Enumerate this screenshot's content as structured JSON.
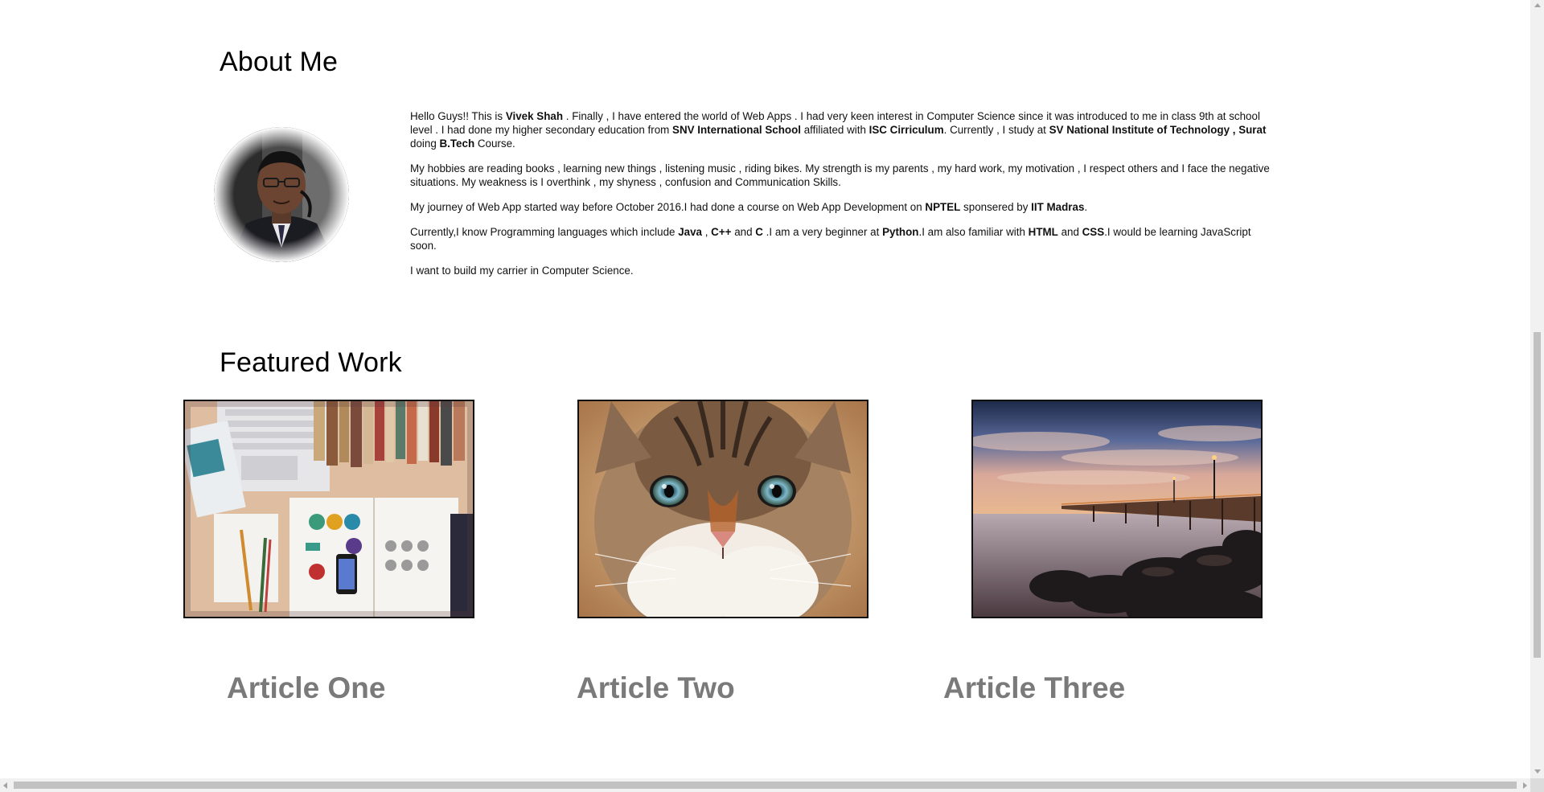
{
  "about": {
    "title": "About Me",
    "avatar_alt": "profile photo",
    "paragraphs": [
      [
        {
          "t": "Hello Guys!! This is "
        },
        {
          "t": "Vivek Shah",
          "b": true
        },
        {
          "t": " . Finally , I have entered the world of Web Apps . I had very keen interest in Computer Science since it was introduced to me in class 9th at school level . I had done my higher secondary education from "
        },
        {
          "t": "SNV International School",
          "b": true
        },
        {
          "t": " affiliated with "
        },
        {
          "t": "ISC Cirriculum",
          "b": true
        },
        {
          "t": ". Currently , I study at "
        },
        {
          "t": "SV National Institute of Technology , Surat",
          "b": true
        },
        {
          "t": " doing "
        },
        {
          "t": "B.Tech",
          "b": true
        },
        {
          "t": " Course."
        }
      ],
      [
        {
          "t": "My hobbies are reading books , learning new things , listening music , riding bikes. My strength is my parents , my hard work, my motivation , I respect others and I face the negative situations. My weakness is I overthink , my shyness , confusion and Communication Skills."
        }
      ],
      [
        {
          "t": "My journey of Web App started way before October 2016.I had done a course on Web App Development on "
        },
        {
          "t": "NPTEL",
          "b": true
        },
        {
          "t": " sponsered by "
        },
        {
          "t": "IIT Madras",
          "b": true
        },
        {
          "t": "."
        }
      ],
      [
        {
          "t": "Currently,I know Programming languages which include "
        },
        {
          "t": "Java",
          "b": true
        },
        {
          "t": " , "
        },
        {
          "t": "C++",
          "b": true
        },
        {
          "t": " and "
        },
        {
          "t": "C",
          "b": true
        },
        {
          "t": " .I am a very beginner at "
        },
        {
          "t": "Python",
          "b": true
        },
        {
          "t": ".I am also familiar with "
        },
        {
          "t": "HTML",
          "b": true
        },
        {
          "t": " and "
        },
        {
          "t": "CSS",
          "b": true
        },
        {
          "t": ".I would be learning JavaScript soon."
        }
      ],
      [
        {
          "t": "I want to build my carrier in Computer Science."
        }
      ]
    ]
  },
  "featured": {
    "title": "Featured Work",
    "articles": [
      {
        "title": "Article One",
        "image": "desk-workspace-photo"
      },
      {
        "title": "Article Two",
        "image": "cat-face-photo"
      },
      {
        "title": "Article Three",
        "image": "pier-sunset-photo"
      }
    ]
  },
  "colors": {
    "article_title": "#7a7a7a",
    "card_border": "#111111",
    "scrollbar_track": "#f1f1f1",
    "scrollbar_thumb": "#c1c1c1"
  }
}
